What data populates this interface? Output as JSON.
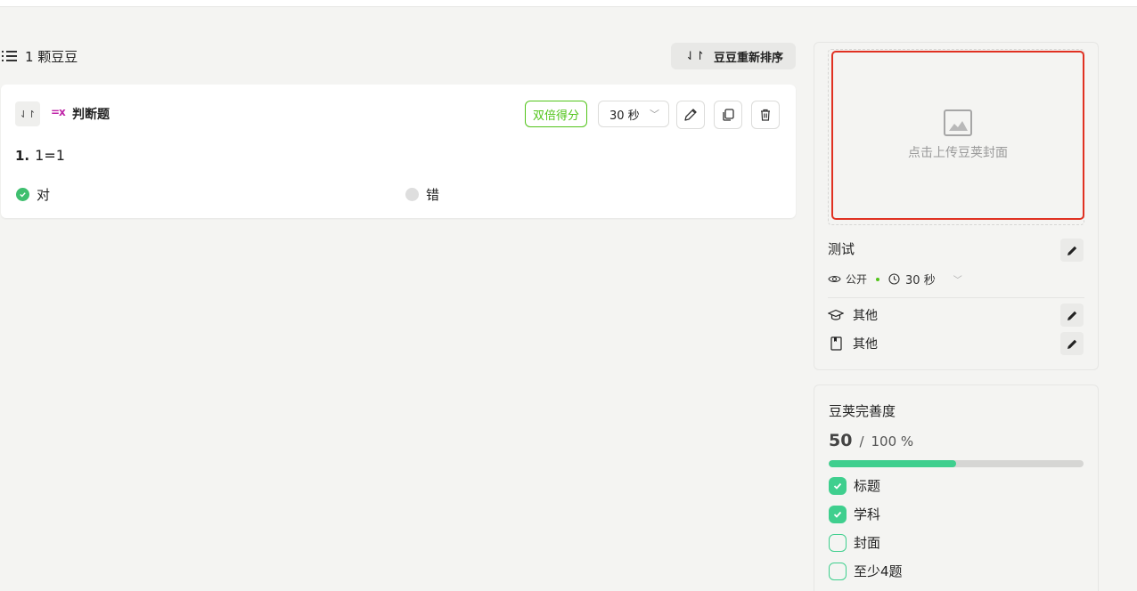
{
  "list": {
    "count_label": "1 颗豆豆",
    "reorder_label": "豆豆重新排序",
    "reorder_glyph": "⇃↾"
  },
  "question": {
    "drag_glyph": "⇃↾",
    "type_glyph": "=x",
    "type_label": "判断题",
    "double_score_label": "双倍得分",
    "time_value": "30 秒",
    "number": "1.",
    "text": "1=1",
    "options": [
      {
        "label": "对",
        "correct": true
      },
      {
        "label": "错",
        "correct": false
      }
    ]
  },
  "info": {
    "cover_upload_label": "点击上传豆荚封面",
    "title": "测试",
    "visibility": "公开",
    "time": "30 秒",
    "subject": "其他",
    "grade": "其他"
  },
  "completeness": {
    "title": "豆荚完善度",
    "score": "50",
    "slash": "/",
    "total": "100 %",
    "progress_fraction": 0.5,
    "items": [
      {
        "label": "标题",
        "done": true
      },
      {
        "label": "学科",
        "done": true
      },
      {
        "label": "封面",
        "done": false
      },
      {
        "label": "至少4题",
        "done": false
      }
    ]
  },
  "colors": {
    "accent_green": "#3fcf8e",
    "highlight_red": "#e03122",
    "double_score_green": "#52c41a"
  }
}
